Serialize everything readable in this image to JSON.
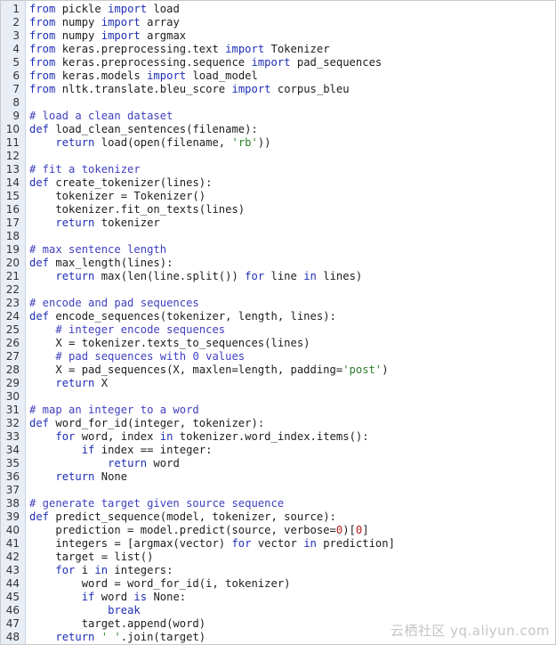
{
  "editor": {
    "lines": [
      {
        "n": "1",
        "tokens": [
          [
            "kw",
            "from"
          ],
          [
            "tx",
            " pickle "
          ],
          [
            "kw",
            "import"
          ],
          [
            "tx",
            " load"
          ]
        ]
      },
      {
        "n": "2",
        "tokens": [
          [
            "kw",
            "from"
          ],
          [
            "tx",
            " numpy "
          ],
          [
            "kw",
            "import"
          ],
          [
            "tx",
            " array"
          ]
        ]
      },
      {
        "n": "3",
        "tokens": [
          [
            "kw",
            "from"
          ],
          [
            "tx",
            " numpy "
          ],
          [
            "kw",
            "import"
          ],
          [
            "tx",
            " argmax"
          ]
        ]
      },
      {
        "n": "4",
        "tokens": [
          [
            "kw",
            "from"
          ],
          [
            "tx",
            " keras.preprocessing.text "
          ],
          [
            "kw",
            "import"
          ],
          [
            "tx",
            " Tokenizer"
          ]
        ]
      },
      {
        "n": "5",
        "tokens": [
          [
            "kw",
            "from"
          ],
          [
            "tx",
            " keras.preprocessing.sequence "
          ],
          [
            "kw",
            "import"
          ],
          [
            "tx",
            " pad_sequences"
          ]
        ]
      },
      {
        "n": "6",
        "tokens": [
          [
            "kw",
            "from"
          ],
          [
            "tx",
            " keras.models "
          ],
          [
            "kw",
            "import"
          ],
          [
            "tx",
            " load_model"
          ]
        ]
      },
      {
        "n": "7",
        "tokens": [
          [
            "kw",
            "from"
          ],
          [
            "tx",
            " nltk.translate.bleu_score "
          ],
          [
            "kw",
            "import"
          ],
          [
            "tx",
            " corpus_bleu"
          ]
        ]
      },
      {
        "n": "8",
        "tokens": []
      },
      {
        "n": "9",
        "tokens": [
          [
            "cm",
            "# load a clean dataset"
          ]
        ]
      },
      {
        "n": "10",
        "tokens": [
          [
            "kw",
            "def"
          ],
          [
            "tx",
            " load_clean_sentences(filename):"
          ]
        ]
      },
      {
        "n": "11",
        "tokens": [
          [
            "tx",
            "    "
          ],
          [
            "kw",
            "return"
          ],
          [
            "tx",
            " load(open(filename, "
          ],
          [
            "st",
            "'rb'"
          ],
          [
            "tx",
            "))"
          ]
        ]
      },
      {
        "n": "12",
        "tokens": []
      },
      {
        "n": "13",
        "tokens": [
          [
            "cm",
            "# fit a tokenizer"
          ]
        ]
      },
      {
        "n": "14",
        "tokens": [
          [
            "kw",
            "def"
          ],
          [
            "tx",
            " create_tokenizer(lines):"
          ]
        ]
      },
      {
        "n": "15",
        "tokens": [
          [
            "tx",
            "    tokenizer = Tokenizer()"
          ]
        ]
      },
      {
        "n": "16",
        "tokens": [
          [
            "tx",
            "    tokenizer.fit_on_texts(lines)"
          ]
        ]
      },
      {
        "n": "17",
        "tokens": [
          [
            "tx",
            "    "
          ],
          [
            "kw",
            "return"
          ],
          [
            "tx",
            " tokenizer"
          ]
        ]
      },
      {
        "n": "18",
        "tokens": []
      },
      {
        "n": "19",
        "tokens": [
          [
            "cm",
            "# max sentence length"
          ]
        ]
      },
      {
        "n": "20",
        "tokens": [
          [
            "kw",
            "def"
          ],
          [
            "tx",
            " max_length(lines):"
          ]
        ]
      },
      {
        "n": "21",
        "tokens": [
          [
            "tx",
            "    "
          ],
          [
            "kw",
            "return"
          ],
          [
            "tx",
            " max(len(line.split()) "
          ],
          [
            "kw",
            "for"
          ],
          [
            "tx",
            " line "
          ],
          [
            "kw",
            "in"
          ],
          [
            "tx",
            " lines)"
          ]
        ]
      },
      {
        "n": "22",
        "tokens": []
      },
      {
        "n": "23",
        "tokens": [
          [
            "cm",
            "# encode and pad sequences"
          ]
        ]
      },
      {
        "n": "24",
        "tokens": [
          [
            "kw",
            "def"
          ],
          [
            "tx",
            " encode_sequences(tokenizer, length, lines):"
          ]
        ]
      },
      {
        "n": "25",
        "tokens": [
          [
            "tx",
            "    "
          ],
          [
            "cm",
            "# integer encode sequences"
          ]
        ]
      },
      {
        "n": "26",
        "tokens": [
          [
            "tx",
            "    X = tokenizer.texts_to_sequences(lines)"
          ]
        ]
      },
      {
        "n": "27",
        "tokens": [
          [
            "tx",
            "    "
          ],
          [
            "cm",
            "# pad sequences with 0 values"
          ]
        ]
      },
      {
        "n": "28",
        "tokens": [
          [
            "tx",
            "    X = pad_sequences(X, maxlen=length, padding="
          ],
          [
            "st",
            "'post'"
          ],
          [
            "tx",
            ")"
          ]
        ]
      },
      {
        "n": "29",
        "tokens": [
          [
            "tx",
            "    "
          ],
          [
            "kw",
            "return"
          ],
          [
            "tx",
            " X"
          ]
        ]
      },
      {
        "n": "30",
        "tokens": []
      },
      {
        "n": "31",
        "tokens": [
          [
            "cm",
            "# map an integer to a word"
          ]
        ]
      },
      {
        "n": "32",
        "tokens": [
          [
            "kw",
            "def"
          ],
          [
            "tx",
            " word_for_id(integer, tokenizer):"
          ]
        ]
      },
      {
        "n": "33",
        "tokens": [
          [
            "tx",
            "    "
          ],
          [
            "kw",
            "for"
          ],
          [
            "tx",
            " word, index "
          ],
          [
            "kw",
            "in"
          ],
          [
            "tx",
            " tokenizer.word_index.items():"
          ]
        ]
      },
      {
        "n": "34",
        "tokens": [
          [
            "tx",
            "        "
          ],
          [
            "kw",
            "if"
          ],
          [
            "tx",
            " index == integer:"
          ]
        ]
      },
      {
        "n": "35",
        "tokens": [
          [
            "tx",
            "            "
          ],
          [
            "kw",
            "return"
          ],
          [
            "tx",
            " word"
          ]
        ]
      },
      {
        "n": "36",
        "tokens": [
          [
            "tx",
            "    "
          ],
          [
            "kw",
            "return"
          ],
          [
            "tx",
            " None"
          ]
        ]
      },
      {
        "n": "37",
        "tokens": []
      },
      {
        "n": "38",
        "tokens": [
          [
            "cm",
            "# generate target given source sequence"
          ]
        ]
      },
      {
        "n": "39",
        "tokens": [
          [
            "kw",
            "def"
          ],
          [
            "tx",
            " predict_sequence(model, tokenizer, source):"
          ]
        ]
      },
      {
        "n": "40",
        "tokens": [
          [
            "tx",
            "    prediction = model.predict(source, verbose="
          ],
          [
            "nu",
            "0"
          ],
          [
            "tx",
            ")["
          ],
          [
            "nu",
            "0"
          ],
          [
            "tx",
            "]"
          ]
        ]
      },
      {
        "n": "41",
        "tokens": [
          [
            "tx",
            "    integers = [argmax(vector) "
          ],
          [
            "kw",
            "for"
          ],
          [
            "tx",
            " vector "
          ],
          [
            "kw",
            "in"
          ],
          [
            "tx",
            " prediction]"
          ]
        ]
      },
      {
        "n": "42",
        "tokens": [
          [
            "tx",
            "    target = list()"
          ]
        ]
      },
      {
        "n": "43",
        "tokens": [
          [
            "tx",
            "    "
          ],
          [
            "kw",
            "for"
          ],
          [
            "tx",
            " i "
          ],
          [
            "kw",
            "in"
          ],
          [
            "tx",
            " integers:"
          ]
        ]
      },
      {
        "n": "44",
        "tokens": [
          [
            "tx",
            "        word = word_for_id(i, tokenizer)"
          ]
        ]
      },
      {
        "n": "45",
        "tokens": [
          [
            "tx",
            "        "
          ],
          [
            "kw",
            "if"
          ],
          [
            "tx",
            " word "
          ],
          [
            "kw",
            "is"
          ],
          [
            "tx",
            " None:"
          ]
        ]
      },
      {
        "n": "46",
        "tokens": [
          [
            "tx",
            "            "
          ],
          [
            "kw",
            "break"
          ]
        ]
      },
      {
        "n": "47",
        "tokens": [
          [
            "tx",
            "        target.append(word)"
          ]
        ]
      },
      {
        "n": "48",
        "tokens": [
          [
            "tx",
            "    "
          ],
          [
            "kw",
            "return"
          ],
          [
            "tx",
            " "
          ],
          [
            "st",
            "' '"
          ],
          [
            "tx",
            ".join(target)"
          ]
        ]
      }
    ]
  },
  "watermark": "云栖社区 yq.aliyun.com",
  "colors": {
    "keyword": "#1e2fb5",
    "comment": "#3f3fbf",
    "string": "#2b7f2b",
    "number": "#b81c1c",
    "gutter_bg": "#e9eef6"
  }
}
